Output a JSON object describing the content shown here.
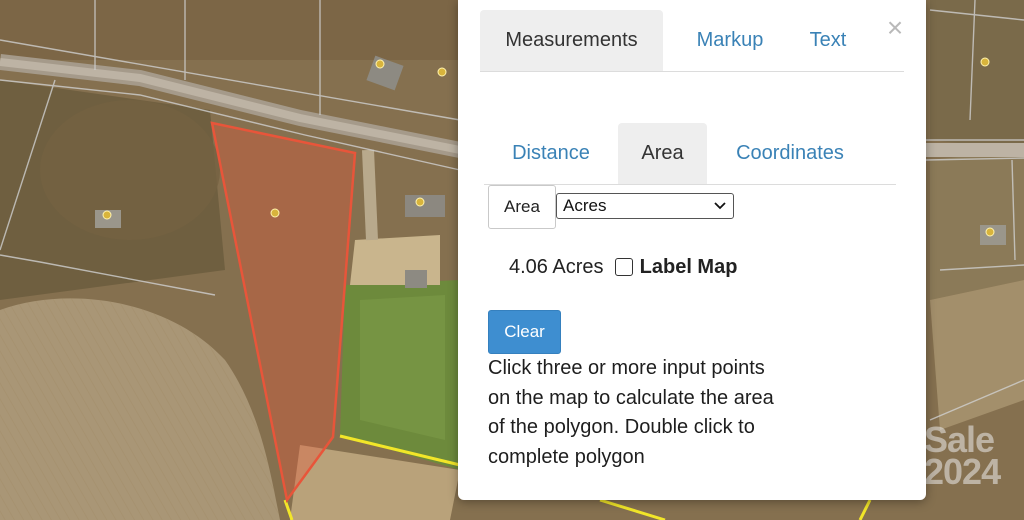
{
  "panel": {
    "close_symbol": "×",
    "top_tabs": [
      {
        "label": "Measurements",
        "active": true
      },
      {
        "label": "Markup",
        "active": false
      },
      {
        "label": "Text",
        "active": false
      }
    ],
    "sub_tabs": [
      {
        "label": "Distance",
        "active": false
      },
      {
        "label": "Area",
        "active": true
      },
      {
        "label": "Coordinates",
        "active": false
      }
    ],
    "area_label": "Area",
    "units": {
      "selected": "Acres"
    },
    "result": {
      "value": "4.06 Acres",
      "checkbox_checked": false,
      "checkbox_label": "Label Map"
    },
    "clear_label": "Clear",
    "instructions": "Click three or more input points on the map to calculate the area of the polygon. Double click to complete polygon"
  },
  "map": {
    "type": "aerial imagery",
    "measured_polygon_color": "#e8553a",
    "parcel_line_color": "#f2e629",
    "watermark_lines": [
      "Sale",
      "2024"
    ]
  },
  "colors": {
    "accent": "#3e8ed0",
    "tab_link": "#3a82b6",
    "active_tab_bg": "#eeeeee"
  },
  "icons": {
    "close": "close-icon",
    "select_chevron": "chevron-down-icon"
  }
}
